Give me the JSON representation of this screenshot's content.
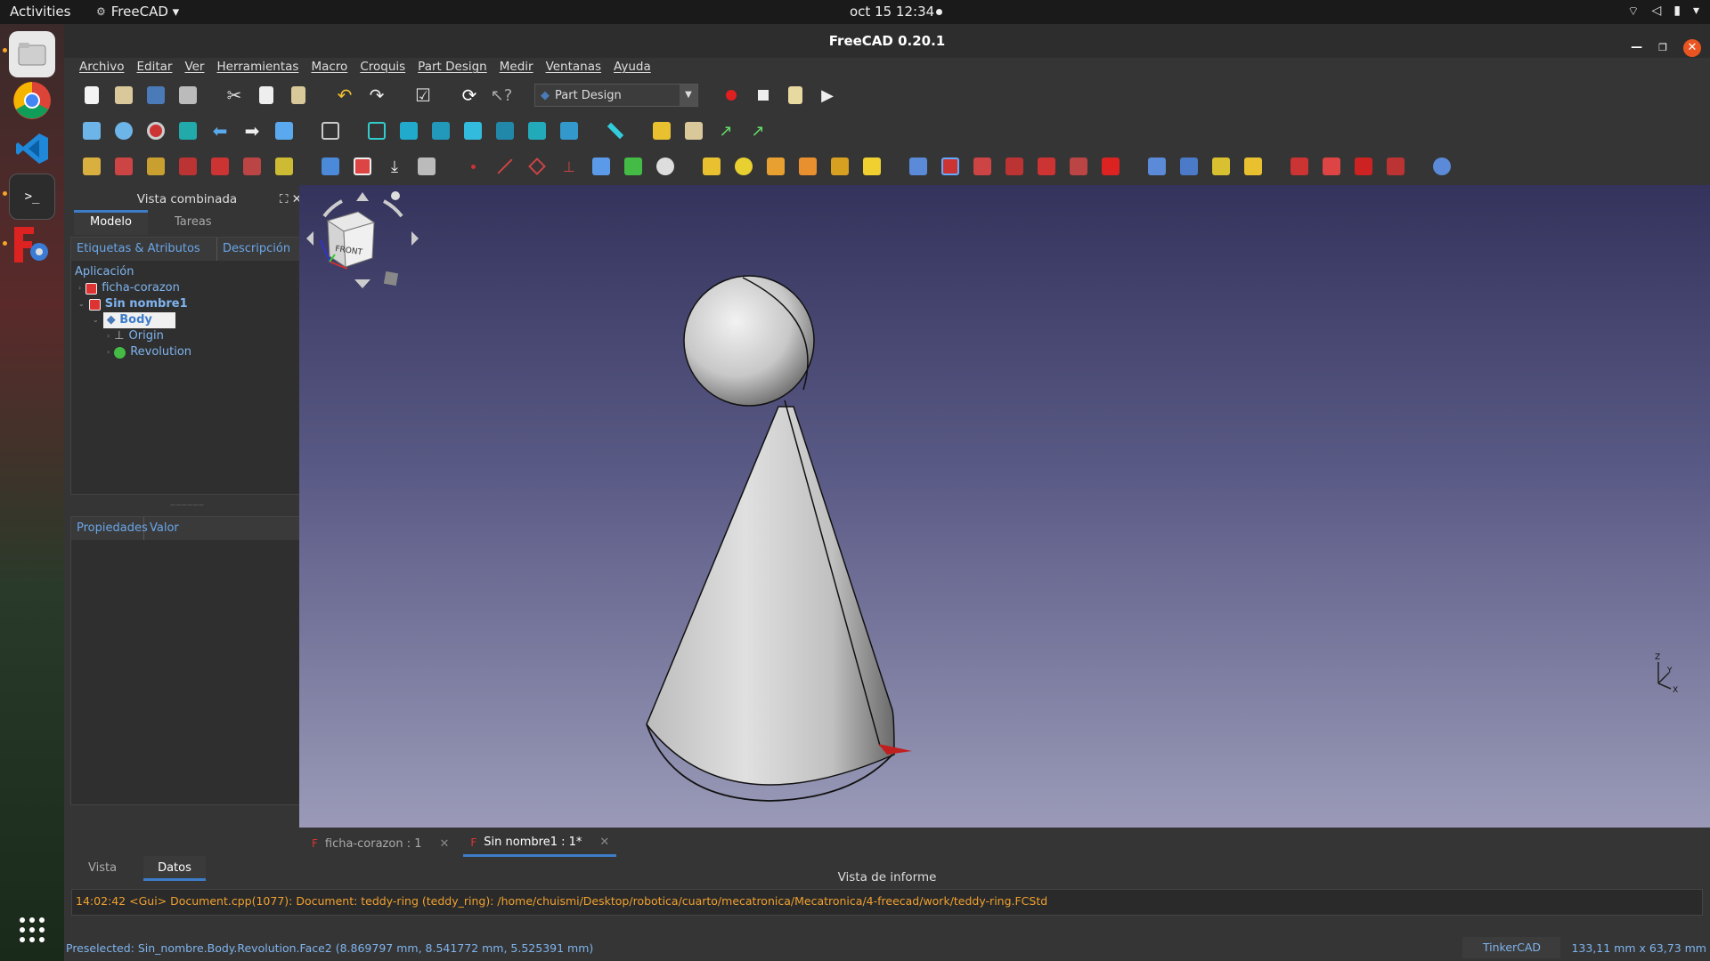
{
  "topbar": {
    "activities": "Activities",
    "app_name": "FreeCAD ▾",
    "datetime": "oct 15  12:34"
  },
  "window": {
    "title": "FreeCAD 0.20.1"
  },
  "menu": [
    "Archivo",
    "Editar",
    "Ver",
    "Herramientas",
    "Macro",
    "Croquis",
    "Part Design",
    "Medir",
    "Ventanas",
    "Ayuda"
  ],
  "workbench": {
    "selected": "Part Design"
  },
  "combo": {
    "title": "Vista combinada",
    "tab_model": "Modelo",
    "tab_tasks": "Tareas",
    "col_labels": "Etiquetas & Atributos",
    "col_desc": "Descripción",
    "tree": {
      "root": "Aplicación",
      "doc1": "ficha-corazon",
      "doc2": "Sin nombre1",
      "body": "Body",
      "origin": "Origin",
      "revolution": "Revolution"
    },
    "prop_col": "Propiedades",
    "value_col": "Valor",
    "tab_view": "Vista",
    "tab_data": "Datos"
  },
  "nav_cube": {
    "face_label": "FRONT"
  },
  "doc_tabs": {
    "tab1": "ficha-corazon : 1",
    "tab2": "Sin nombre1 : 1*"
  },
  "report": {
    "title": "Vista de informe",
    "log_line": "14:02:42  <Gui> Document.cpp(1077):   Document: teddy-ring (teddy_ring): /home/chuismi/Desktop/robotica/cuarto/mecatronica/Mecatronica/4-freecad/work/teddy-ring.FCStd"
  },
  "status": {
    "preselected": "Preselected: Sin_nombre.Body.Revolution.Face2 (8.869797 mm, 8.541772 mm, 5.525391 mm)",
    "navigation": "TinkerCAD",
    "dimensions": "133,11 mm x 63,73 mm"
  },
  "colors": {
    "accent": "#3d7cc9",
    "close_button": "#e95420",
    "log_text": "#f0a030",
    "tree_text": "#7fb4ee"
  }
}
